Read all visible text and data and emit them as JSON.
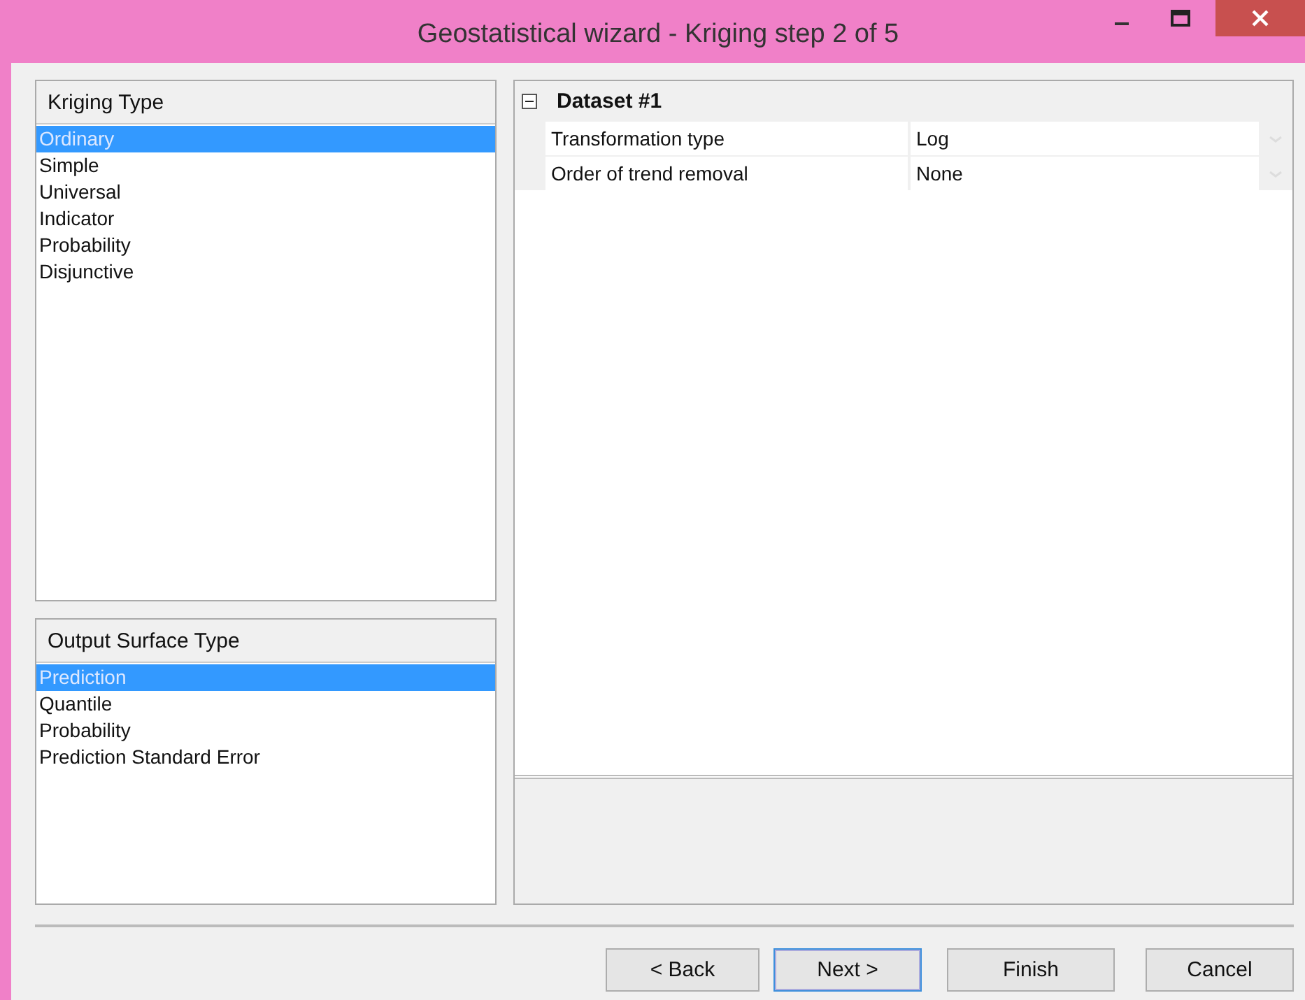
{
  "window": {
    "title": "Geostatistical wizard - Kriging step 2 of 5"
  },
  "kriging_type": {
    "header": "Kriging Type",
    "items": [
      {
        "label": "Ordinary",
        "selected": true
      },
      {
        "label": "Simple",
        "selected": false
      },
      {
        "label": "Universal",
        "selected": false
      },
      {
        "label": "Indicator",
        "selected": false
      },
      {
        "label": "Probability",
        "selected": false
      },
      {
        "label": "Disjunctive",
        "selected": false
      }
    ]
  },
  "output_surface_type": {
    "header": "Output Surface Type",
    "items": [
      {
        "label": "Prediction",
        "selected": true
      },
      {
        "label": "Quantile",
        "selected": false
      },
      {
        "label": "Probability",
        "selected": false
      },
      {
        "label": "Prediction Standard Error",
        "selected": false
      }
    ]
  },
  "property_grid": {
    "group": {
      "title": "Dataset #1",
      "expanded": true
    },
    "rows": [
      {
        "name": "Transformation type",
        "value": "Log"
      },
      {
        "name": "Order of trend removal",
        "value": "None"
      }
    ]
  },
  "buttons": [
    {
      "label": "< Back",
      "default": false
    },
    {
      "label": "Next >",
      "default": true
    },
    {
      "label": "Finish",
      "default": false
    },
    {
      "label": "Cancel",
      "default": false
    }
  ]
}
